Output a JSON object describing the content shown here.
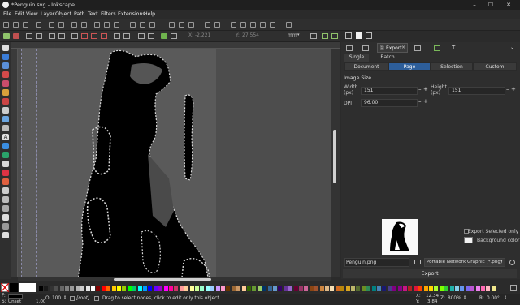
{
  "window": {
    "title": "*Penguin.svg - Inkscape",
    "minimize": "–",
    "maximize": "☐",
    "close": "✕"
  },
  "menu": [
    "File",
    "Edit",
    "View",
    "Layer",
    "Object",
    "Path",
    "Text",
    "Filters",
    "Extensions",
    "Help"
  ],
  "node_toolbar": {
    "x_label": "X:",
    "x_value": "-2.221",
    "y_label": "Y:",
    "y_value": "27.554",
    "unit": "mm"
  },
  "dock_tabs": {
    "export_tab": "Export",
    "export_close": "×"
  },
  "export": {
    "tabs": [
      "Single File",
      "Batch Export"
    ],
    "area_buttons": [
      "Document",
      "Page",
      "Selection",
      "Custom"
    ],
    "active_area": "Page",
    "image_size_label": "Image Size",
    "width_label": "Width (px)",
    "width_value": "151",
    "height_label": "Height (px)",
    "height_value": "151",
    "dpi_label": "DPI",
    "dpi_value": "96.00",
    "export_selected_label": "Export Selected only",
    "background_label": "Background color",
    "filename": "Penguin.png",
    "format": "Portable Network Graphic (*.png)",
    "export_button": "Export"
  },
  "status": {
    "fill_label": "F:",
    "stroke_label": "S:",
    "stroke_value": "Unset",
    "stroke_width": "1.00",
    "opacity_label": "O:",
    "opacity_value": "100",
    "layer": "[root]",
    "message": "Drag to select nodes, click to edit only this object",
    "x_label": "X:",
    "x_value": "12.34",
    "y_label": "Y:",
    "y_value": "3.84",
    "zoom_label": "Z:",
    "zoom_value": "800%",
    "rotate_label": "R:",
    "rotate_value": "0.00°"
  },
  "colors": {
    "accent": "#2d5e9a",
    "palette": [
      "#000000",
      "#1a1a1a",
      "#333333",
      "#4d4d4d",
      "#666666",
      "#808080",
      "#999999",
      "#b3b3b3",
      "#cccccc",
      "#e6e6e6",
      "#ffffff",
      "#800000",
      "#ff0000",
      "#ff6600",
      "#ffcc00",
      "#ffff00",
      "#99cc00",
      "#00ff00",
      "#00cc66",
      "#00ffff",
      "#0099ff",
      "#0000ff",
      "#6600ff",
      "#9900cc",
      "#ff00ff",
      "#ff0099",
      "#cc3366",
      "#ff9999",
      "#ffcc99",
      "#ffff99",
      "#ccff99",
      "#99ffcc",
      "#99ffff",
      "#99ccff",
      "#cc99ff",
      "#ff99cc",
      "#663300",
      "#996633",
      "#cc9966",
      "#ffcc99",
      "#336600",
      "#669933",
      "#99cc66",
      "#003366",
      "#336699",
      "#6699cc",
      "#330066",
      "#663399",
      "#9966cc",
      "#660033",
      "#993366",
      "#cc6699",
      "#8b4513",
      "#a0522d",
      "#cd853f",
      "#deb887",
      "#f5deb3",
      "#d2691e",
      "#b8860b",
      "#daa520",
      "#bdb76b",
      "#556b2f",
      "#6b8e23",
      "#2e8b57",
      "#008080",
      "#4682b4",
      "#191970",
      "#483d8b",
      "#800080",
      "#8b008b",
      "#c71585",
      "#b22222",
      "#dc143c",
      "#ff4500",
      "#ffa500",
      "#ffd700",
      "#adff2f",
      "#7fff00",
      "#32cd32",
      "#20b2aa",
      "#87ceeb",
      "#6495ed",
      "#7b68ee",
      "#ba55d3",
      "#ee82ee",
      "#ff69b4",
      "#ffb6c1",
      "#f0e68c"
    ]
  }
}
